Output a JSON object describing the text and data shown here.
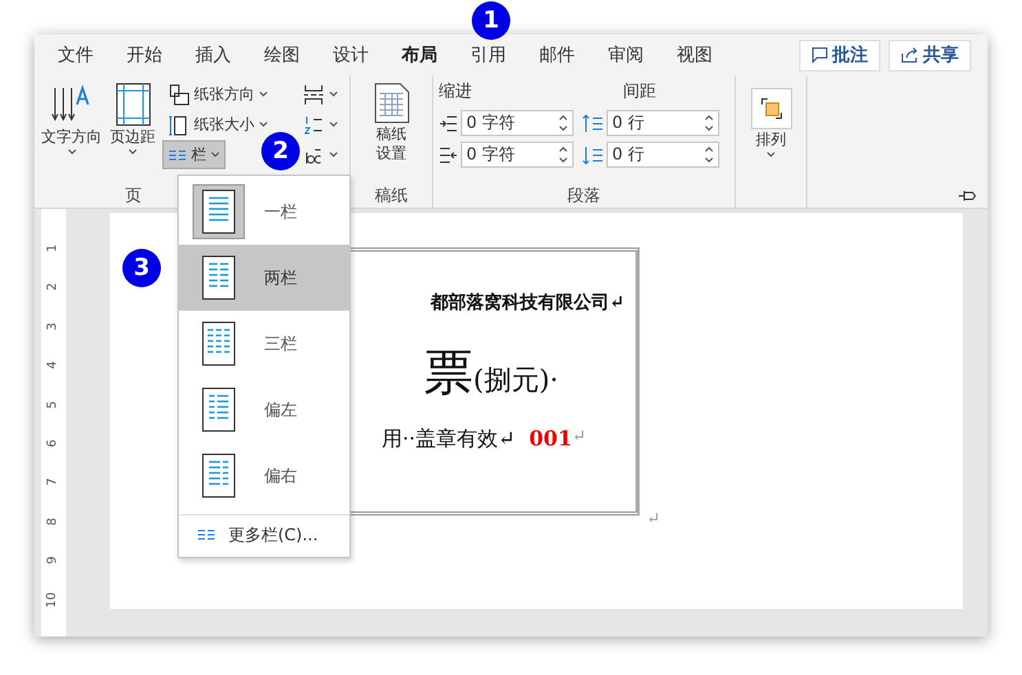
{
  "tabs": [
    {
      "label": "文件",
      "selected": false
    },
    {
      "label": "开始",
      "selected": false
    },
    {
      "label": "插入",
      "selected": false
    },
    {
      "label": "绘图",
      "selected": false
    },
    {
      "label": "设计",
      "selected": false
    },
    {
      "label": "布局",
      "selected": true
    },
    {
      "label": "引用",
      "selected": false
    },
    {
      "label": "邮件",
      "selected": false
    },
    {
      "label": "审阅",
      "selected": false
    },
    {
      "label": "视图",
      "selected": false
    }
  ],
  "header_buttons": [
    {
      "label": "批注",
      "kind": "comment"
    },
    {
      "label": "共享",
      "kind": "share"
    }
  ],
  "page_setup": {
    "text_direction": "文字方向",
    "margins": "页边距",
    "orientation": "纸张方向",
    "size": "纸张大小",
    "columns": "栏",
    "columns_pressed": true,
    "group_label": "页"
  },
  "manuscript": {
    "button": "稿纸设置",
    "group_label": "稿纸"
  },
  "paragraph": {
    "indent_label": "缩进",
    "spacing_label": "间距",
    "indent_left": "0 字符",
    "indent_right": "0 字符",
    "spacing_before": "0 行",
    "spacing_after": "0 行",
    "group_label": "段落"
  },
  "arrange": {
    "label": "排列"
  },
  "column_menu": {
    "items": [
      {
        "label": "一栏",
        "kind": "one",
        "selected": true,
        "hovered": false
      },
      {
        "label": "两栏",
        "kind": "two",
        "selected": false,
        "hovered": true
      },
      {
        "label": "三栏",
        "kind": "three",
        "selected": false,
        "hovered": false
      },
      {
        "label": "偏左",
        "kind": "left",
        "selected": false,
        "hovered": false
      },
      {
        "label": "偏右",
        "kind": "right",
        "selected": false,
        "hovered": false
      }
    ],
    "more": "更多栏(C)..."
  },
  "document": {
    "company": "都部落窝科技有限公司↵",
    "title": "票",
    "price": "(捌元)·",
    "note": "用··盖章有效↵",
    "serial": "001",
    "serial_mark": "↵",
    "end_mark": "↵"
  },
  "ruler": [
    "1",
    "2",
    "3",
    "4",
    "5",
    "6",
    "7",
    "8",
    "9",
    "10"
  ],
  "callouts": [
    "1",
    "2",
    "3"
  ]
}
